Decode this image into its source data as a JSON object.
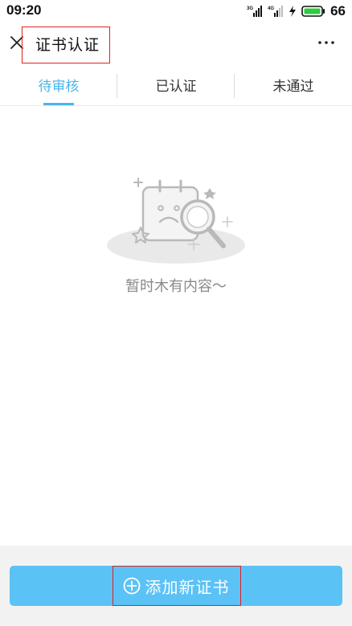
{
  "status_bar": {
    "time": "09:20",
    "battery_level": "66",
    "network_1": "3G",
    "network_2": "4G",
    "icons": [
      "signal-icon",
      "signal-icon",
      "charging-icon",
      "battery-icon"
    ]
  },
  "header": {
    "title": "证书认证",
    "close_icon": "close-icon",
    "more_icon": "more-icon"
  },
  "tabs": [
    {
      "label": "待审核",
      "active": true
    },
    {
      "label": "已认证",
      "active": false
    },
    {
      "label": "未通过",
      "active": false
    }
  ],
  "empty_state": {
    "message": "暂时木有内容～",
    "illustration": "empty-calendar-search-icon"
  },
  "footer": {
    "add_button_label": "添加新证书",
    "add_icon": "plus-circle-icon"
  },
  "colors": {
    "accent": "#4ab6ea",
    "button": "#5bc2f6",
    "battery": "#2ecc40",
    "highlight_box": "#e02020"
  }
}
